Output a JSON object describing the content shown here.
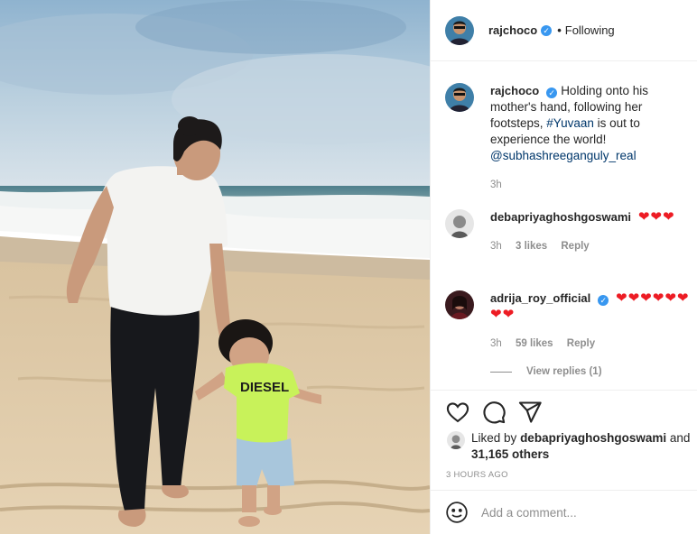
{
  "post": {
    "author": "rajchoco",
    "follow_status": "Following",
    "follow_sep": "•"
  },
  "caption": {
    "author": "rajchoco",
    "text_before": "Holding onto his mother's hand, following her footsteps, ",
    "hashtag": "#Yuvaan",
    "text_after": " is out to experience the world!",
    "mention": "@subhashreeganguly_real",
    "time": "3h"
  },
  "comments": [
    {
      "author": "debapriyaghoshgoswami",
      "text": "❤❤❤",
      "time": "3h",
      "likes": "3 likes",
      "reply_label": "Reply"
    },
    {
      "author": "adrija_roy_official",
      "text": "❤❤❤❤❤❤❤❤",
      "time": "3h",
      "likes": "59 likes",
      "reply_label": "Reply",
      "view_replies": "View replies (1)"
    }
  ],
  "likes_line": {
    "prefix": "Liked by",
    "user": "debapriyaghoshgoswami",
    "and": "and",
    "others": "31,165 others"
  },
  "timestamp": "3 HOURS AGO",
  "comment_box": {
    "placeholder": "Add a comment..."
  },
  "icons": {
    "like": "heart-icon",
    "comment": "comment-icon",
    "share": "share-icon",
    "emoji": "emoji-icon",
    "verified": "verified-badge-icon"
  },
  "colors": {
    "verified": "#3897f0",
    "link": "#00376b",
    "muted": "#8e8e8e",
    "heart": "#ed1c24"
  }
}
